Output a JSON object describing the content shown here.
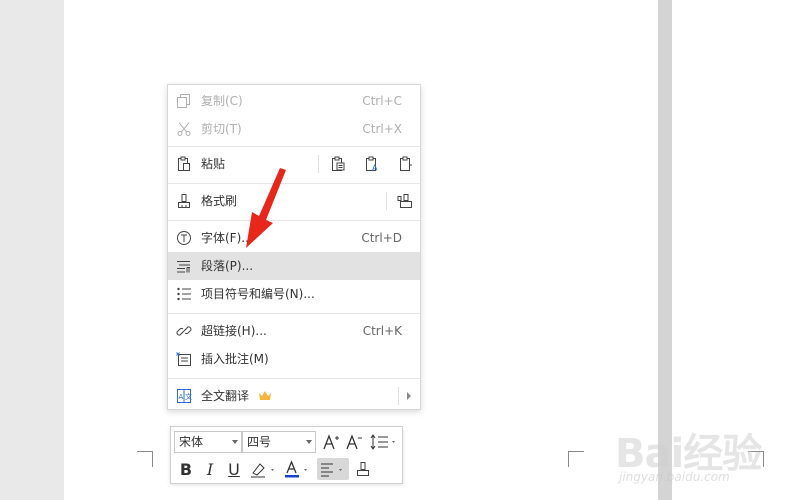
{
  "context_menu": {
    "copy": {
      "label": "复制(C)",
      "shortcut": "Ctrl+C"
    },
    "cut": {
      "label": "剪切(T)",
      "shortcut": "Ctrl+X"
    },
    "paste": {
      "label": "粘贴"
    },
    "format_painter": {
      "label": "格式刷"
    },
    "font": {
      "label": "字体(F)...",
      "shortcut": "Ctrl+D"
    },
    "paragraph": {
      "label": "段落(P)..."
    },
    "bullets": {
      "label": "项目符号和编号(N)..."
    },
    "hyperlink": {
      "label": "超链接(H)...",
      "shortcut": "Ctrl+K"
    },
    "insert_comment": {
      "label": "插入批注(M)"
    },
    "translate": {
      "label": "全文翻译"
    }
  },
  "mini_toolbar": {
    "font_name": "宋体",
    "font_size": "四号",
    "bold": "B",
    "italic": "I",
    "underline": "U"
  },
  "watermark": {
    "brand": "Bai经验",
    "site": "jingyan.baidu.com"
  },
  "colors": {
    "highlight_row": "#e2e2e2",
    "arrow": "#e8271b",
    "font_color_bar": "#1a3fd1",
    "crown": "#f4b63f"
  }
}
